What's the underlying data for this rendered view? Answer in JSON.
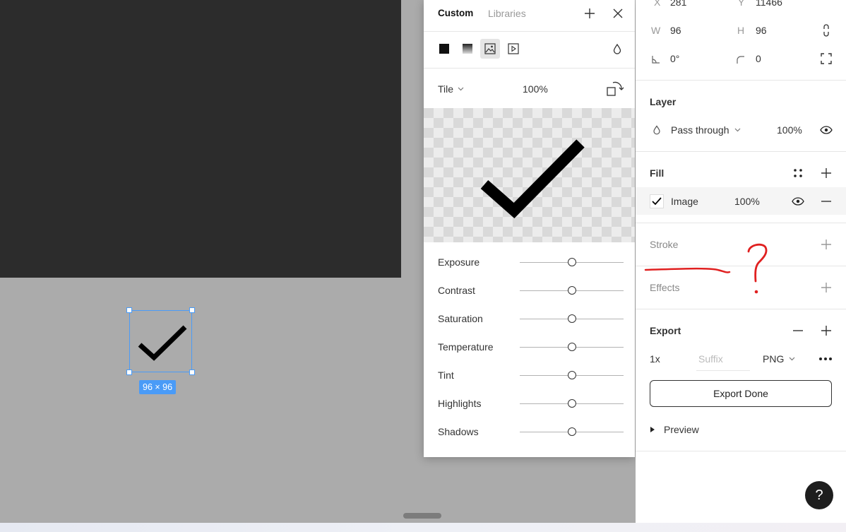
{
  "canvas": {
    "selection_size": "96 × 96"
  },
  "popup": {
    "tabs": [
      "Custom",
      "Libraries"
    ],
    "mode": "Tile",
    "scale": "100%",
    "adjustments": [
      {
        "label": "Exposure",
        "value": 0.5
      },
      {
        "label": "Contrast",
        "value": 0.5
      },
      {
        "label": "Saturation",
        "value": 0.5
      },
      {
        "label": "Temperature",
        "value": 0.5
      },
      {
        "label": "Tint",
        "value": 0.5
      },
      {
        "label": "Highlights",
        "value": 0.5
      },
      {
        "label": "Shadows",
        "value": 0.5
      }
    ]
  },
  "panel": {
    "x_label": "X",
    "x_value": "281",
    "y_label": "Y",
    "y_value": "11466",
    "w_label": "W",
    "w_value": "96",
    "h_label": "H",
    "h_value": "96",
    "rotation": "0°",
    "corner_radius": "0",
    "layer": {
      "title": "Layer",
      "blend": "Pass through",
      "opacity": "100%"
    },
    "fill": {
      "title": "Fill",
      "type": "Image",
      "opacity": "100%"
    },
    "stroke": {
      "title": "Stroke"
    },
    "effects": {
      "title": "Effects"
    },
    "export": {
      "title": "Export",
      "scale": "1x",
      "suffix_placeholder": "Suffix",
      "format": "PNG",
      "button": "Export Done",
      "preview": "Preview"
    },
    "help": "?"
  },
  "annotation": {
    "mark": "?",
    "color": "#e02020"
  },
  "colors": {
    "selection": "#4a9bf7",
    "canvas": "#ababab",
    "frame": "#2c2c2c"
  }
}
